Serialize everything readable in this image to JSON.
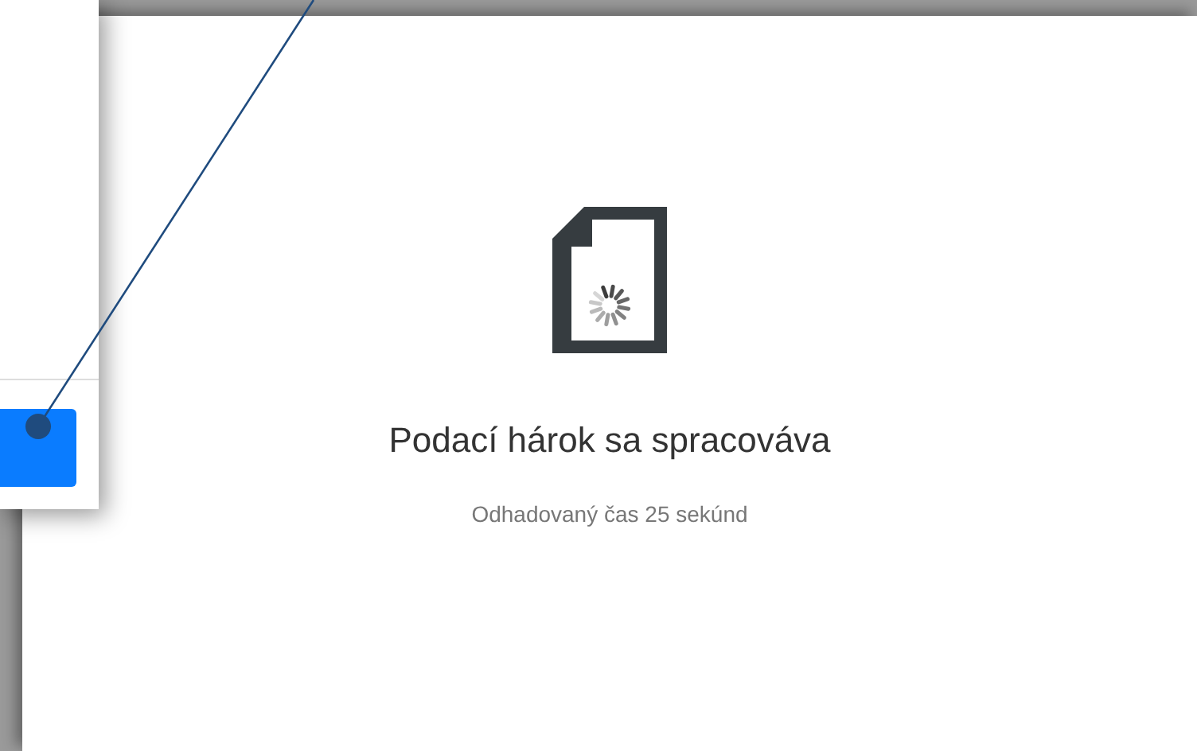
{
  "status": {
    "title": "Podací hárok sa spracováva",
    "subtitle": "Odhadovaný čas 25 sekúnd"
  },
  "popup": {
    "button": {
      "kind": "primary"
    }
  }
}
